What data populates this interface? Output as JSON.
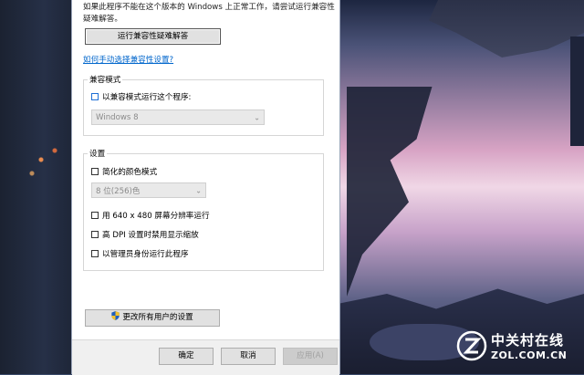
{
  "dialog": {
    "intro_text": "如果此程序不能在这个版本的 Windows 上正常工作，请尝试运行兼容性疑难解答。",
    "run_troubleshooter_button": "运行兼容性疑难解答",
    "manual_link": "如何手动选择兼容性设置?",
    "compat_mode": {
      "title": "兼容模式",
      "checkbox_label": "以兼容模式运行这个程序:",
      "checked": false,
      "select_value": "Windows 8"
    },
    "settings": {
      "title": "设置",
      "reduced_color_label": "简化的颜色模式",
      "reduced_color_checked": false,
      "color_select_value": "8 位(256)色",
      "res_640_label": "用 640 x 480 屏幕分辨率运行",
      "high_dpi_label": "高 DPI 设置时禁用显示缩放",
      "run_as_admin_label": "以管理员身份运行此程序"
    },
    "change_all_users_button": "更改所有用户的设置",
    "footer": {
      "ok": "确定",
      "cancel": "取消",
      "apply": "应用(A)"
    }
  },
  "watermark": {
    "brand_cn": "中关村在线",
    "brand_en": "ZOL.COM.CN"
  },
  "icons": [
    "shield-icon",
    "chevron-down-icon",
    "zol-logo-icon"
  ],
  "colors": {
    "link": "#0066cc",
    "checkbox_focus": "#1e6fd6"
  }
}
